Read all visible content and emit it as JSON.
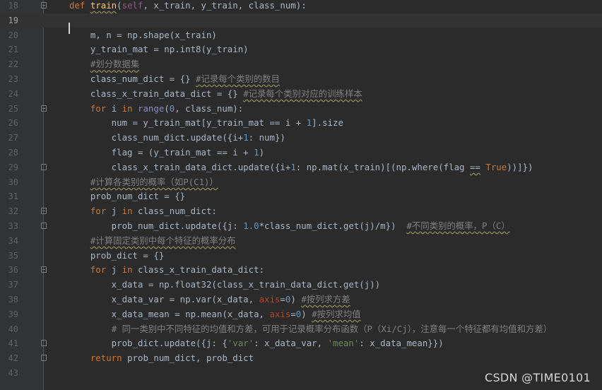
{
  "editor": {
    "first_line_number": 18,
    "current_line": 19,
    "lines": [
      {
        "n": "18",
        "fold": "open",
        "tokens": [
          [
            "kw",
            "def "
          ],
          [
            "fn",
            "train"
          ],
          [
            "p",
            "("
          ],
          [
            "self",
            "self"
          ],
          [
            "p",
            ", x_train, y_train, class_num):"
          ]
        ]
      },
      {
        "n": "19",
        "fold": "",
        "tokens": []
      },
      {
        "n": "20",
        "fold": "",
        "tokens": [
          [
            "p",
            "    m, n = np.shape(x_train)"
          ]
        ]
      },
      {
        "n": "21",
        "fold": "",
        "tokens": [
          [
            "p",
            "    y_train_mat = np.int8(y_train)"
          ]
        ]
      },
      {
        "n": "22",
        "fold": "",
        "tokens": [
          [
            "p",
            "    "
          ],
          [
            "cm-u",
            "#划分数据集"
          ]
        ]
      },
      {
        "n": "23",
        "fold": "",
        "tokens": [
          [
            "p",
            "    class_num_dict = {} "
          ],
          [
            "cm-u",
            "#记录每个类别的数目"
          ]
        ]
      },
      {
        "n": "24",
        "fold": "",
        "tokens": [
          [
            "p",
            "    class_x_train_data_dict = {} "
          ],
          [
            "cm-u",
            "#记录每个类别对应的训练样本"
          ]
        ]
      },
      {
        "n": "25",
        "fold": "open",
        "tokens": [
          [
            "p",
            "    "
          ],
          [
            "kw",
            "for "
          ],
          [
            "p",
            "i "
          ],
          [
            "kw",
            "in "
          ],
          [
            "builtin",
            "range"
          ],
          [
            "p",
            "("
          ],
          [
            "num",
            "0"
          ],
          [
            "p",
            ", class_num):"
          ]
        ]
      },
      {
        "n": "26",
        "fold": "",
        "tokens": [
          [
            "p",
            "        num = y_train_mat[y_train_mat == i + "
          ],
          [
            "num",
            "1"
          ],
          [
            "p",
            "].size"
          ]
        ]
      },
      {
        "n": "27",
        "fold": "",
        "tokens": [
          [
            "p",
            "        class_num_dict.update({i+"
          ],
          [
            "num",
            "1"
          ],
          [
            "p",
            ": num})"
          ]
        ]
      },
      {
        "n": "28",
        "fold": "",
        "tokens": [
          [
            "p",
            "        flag = (y_train_mat == i + "
          ],
          [
            "num",
            "1"
          ],
          [
            "p",
            ")"
          ]
        ]
      },
      {
        "n": "29",
        "fold": "close",
        "tokens": [
          [
            "p",
            "        class_x_train_data_dict.update({i+"
          ],
          [
            "num",
            "1"
          ],
          [
            "p",
            ": np.mat(x_train)[(np.where(flag "
          ],
          [
            "wavy",
            "=="
          ],
          [
            "p",
            " "
          ],
          [
            "kw",
            "True"
          ],
          [
            "p",
            "))]})"
          ]
        ]
      },
      {
        "n": "30",
        "fold": "",
        "tokens": [
          [
            "p",
            "    "
          ],
          [
            "cm-u",
            "#计算各类别的概率（如P(C1)）"
          ]
        ]
      },
      {
        "n": "31",
        "fold": "",
        "tokens": [
          [
            "p",
            "    prob_num_dict = {}"
          ]
        ]
      },
      {
        "n": "32",
        "fold": "open",
        "tokens": [
          [
            "p",
            "    "
          ],
          [
            "kw",
            "for "
          ],
          [
            "p",
            "j "
          ],
          [
            "kw",
            "in "
          ],
          [
            "p",
            "class_num_dict:"
          ]
        ]
      },
      {
        "n": "33",
        "fold": "close",
        "tokens": [
          [
            "p",
            "        prob_num_dict.update({j: "
          ],
          [
            "num",
            "1.0"
          ],
          [
            "p",
            "*class_num_dict.get(j)/m})  "
          ],
          [
            "cm-u",
            "#不同类别的概率，P（C）"
          ]
        ]
      },
      {
        "n": "34",
        "fold": "",
        "tokens": [
          [
            "p",
            "    "
          ],
          [
            "cm-u",
            "#计算固定类别中每个特征的概率分布"
          ]
        ]
      },
      {
        "n": "35",
        "fold": "",
        "tokens": [
          [
            "p",
            "    prob_dict = {}"
          ]
        ]
      },
      {
        "n": "36",
        "fold": "open",
        "tokens": [
          [
            "p",
            "    "
          ],
          [
            "kw",
            "for "
          ],
          [
            "p",
            "j "
          ],
          [
            "kw",
            "in "
          ],
          [
            "p",
            "class_x_train_data_dict:"
          ]
        ]
      },
      {
        "n": "37",
        "fold": "",
        "tokens": [
          [
            "p",
            "        x_data = np.float32(class_x_train_data_dict.get(j))"
          ]
        ]
      },
      {
        "n": "38",
        "fold": "",
        "tokens": [
          [
            "p",
            "        x_data_var = np.var(x_data, "
          ],
          [
            "kwarg",
            "axis"
          ],
          [
            "p",
            "="
          ],
          [
            "num",
            "0"
          ],
          [
            "p",
            ") "
          ],
          [
            "cm-u",
            "#按列求方差"
          ]
        ]
      },
      {
        "n": "39",
        "fold": "",
        "tokens": [
          [
            "p",
            "        x_data_mean = np.mean(x_data, "
          ],
          [
            "kwarg",
            "axis"
          ],
          [
            "p",
            "="
          ],
          [
            "num",
            "0"
          ],
          [
            "p",
            ") "
          ],
          [
            "cm-u",
            "#按列求均值"
          ]
        ]
      },
      {
        "n": "40",
        "fold": "",
        "tokens": [
          [
            "p",
            "        "
          ],
          [
            "cm",
            "# 同一类别中不同特征的均值和方差，可用于记录概率分布函数（P（Xi/Cj），注意每一个特征都有均值和方差）"
          ]
        ]
      },
      {
        "n": "41",
        "fold": "close",
        "tokens": [
          [
            "p",
            "        prob_dict.update({j: {"
          ],
          [
            "str",
            "'var'"
          ],
          [
            "p",
            ": x_data_var, "
          ],
          [
            "str",
            "'mean'"
          ],
          [
            "p",
            ": x_data_mean}})"
          ]
        ]
      },
      {
        "n": "42",
        "fold": "close",
        "tokens": [
          [
            "p",
            "    "
          ],
          [
            "kw",
            "return "
          ],
          [
            "p",
            "prob_num_dict, prob_dict"
          ]
        ]
      },
      {
        "n": "43",
        "fold": "",
        "tokens": []
      }
    ]
  },
  "watermark": "CSDN @TIME0101"
}
